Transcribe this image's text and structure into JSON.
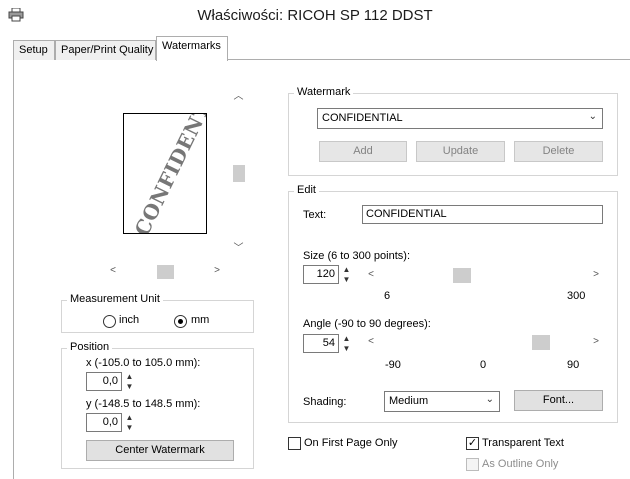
{
  "window": {
    "title": "Właściwości: RICOH SP 112 DDST"
  },
  "tabs": [
    {
      "label": "Setup"
    },
    {
      "label": "Paper/Print Quality"
    },
    {
      "label": "Watermarks"
    }
  ],
  "preview": {
    "watermark_text": "CONFIDENTIAL"
  },
  "measurement": {
    "label": "Measurement Unit",
    "inch_label": "inch",
    "mm_label": "mm",
    "selected": "mm"
  },
  "position": {
    "label": "Position",
    "x_label": "x (-105.0 to 105.0 mm):",
    "x_value": "0,0",
    "y_label": "y (-148.5 to 148.5 mm):",
    "y_value": "0,0",
    "center_button": "Center Watermark"
  },
  "watermark": {
    "label": "Watermark",
    "selected": "CONFIDENTIAL",
    "add_button": "Add",
    "update_button": "Update",
    "delete_button": "Delete"
  },
  "edit": {
    "label": "Edit",
    "text_label": "Text:",
    "text_value": "CONFIDENTIAL",
    "size_label": "Size (6 to 300 points):",
    "size_value": "120",
    "size_min_label": "6",
    "size_max_label": "300",
    "size_fraction": 0.387,
    "angle_label": "Angle (-90 to 90 degrees):",
    "angle_value": "54",
    "angle_min_label": "-90",
    "angle_mid_label": "0",
    "angle_max_label": "90",
    "angle_fraction": 0.8,
    "shading_label": "Shading:",
    "shading_value": "Medium",
    "font_button": "Font..."
  },
  "options": {
    "first_page_label": "On First Page Only",
    "first_page_checked": false,
    "transparent_label": "Transparent Text",
    "transparent_checked": true,
    "outline_label": "As Outline Only",
    "outline_checked": false
  }
}
